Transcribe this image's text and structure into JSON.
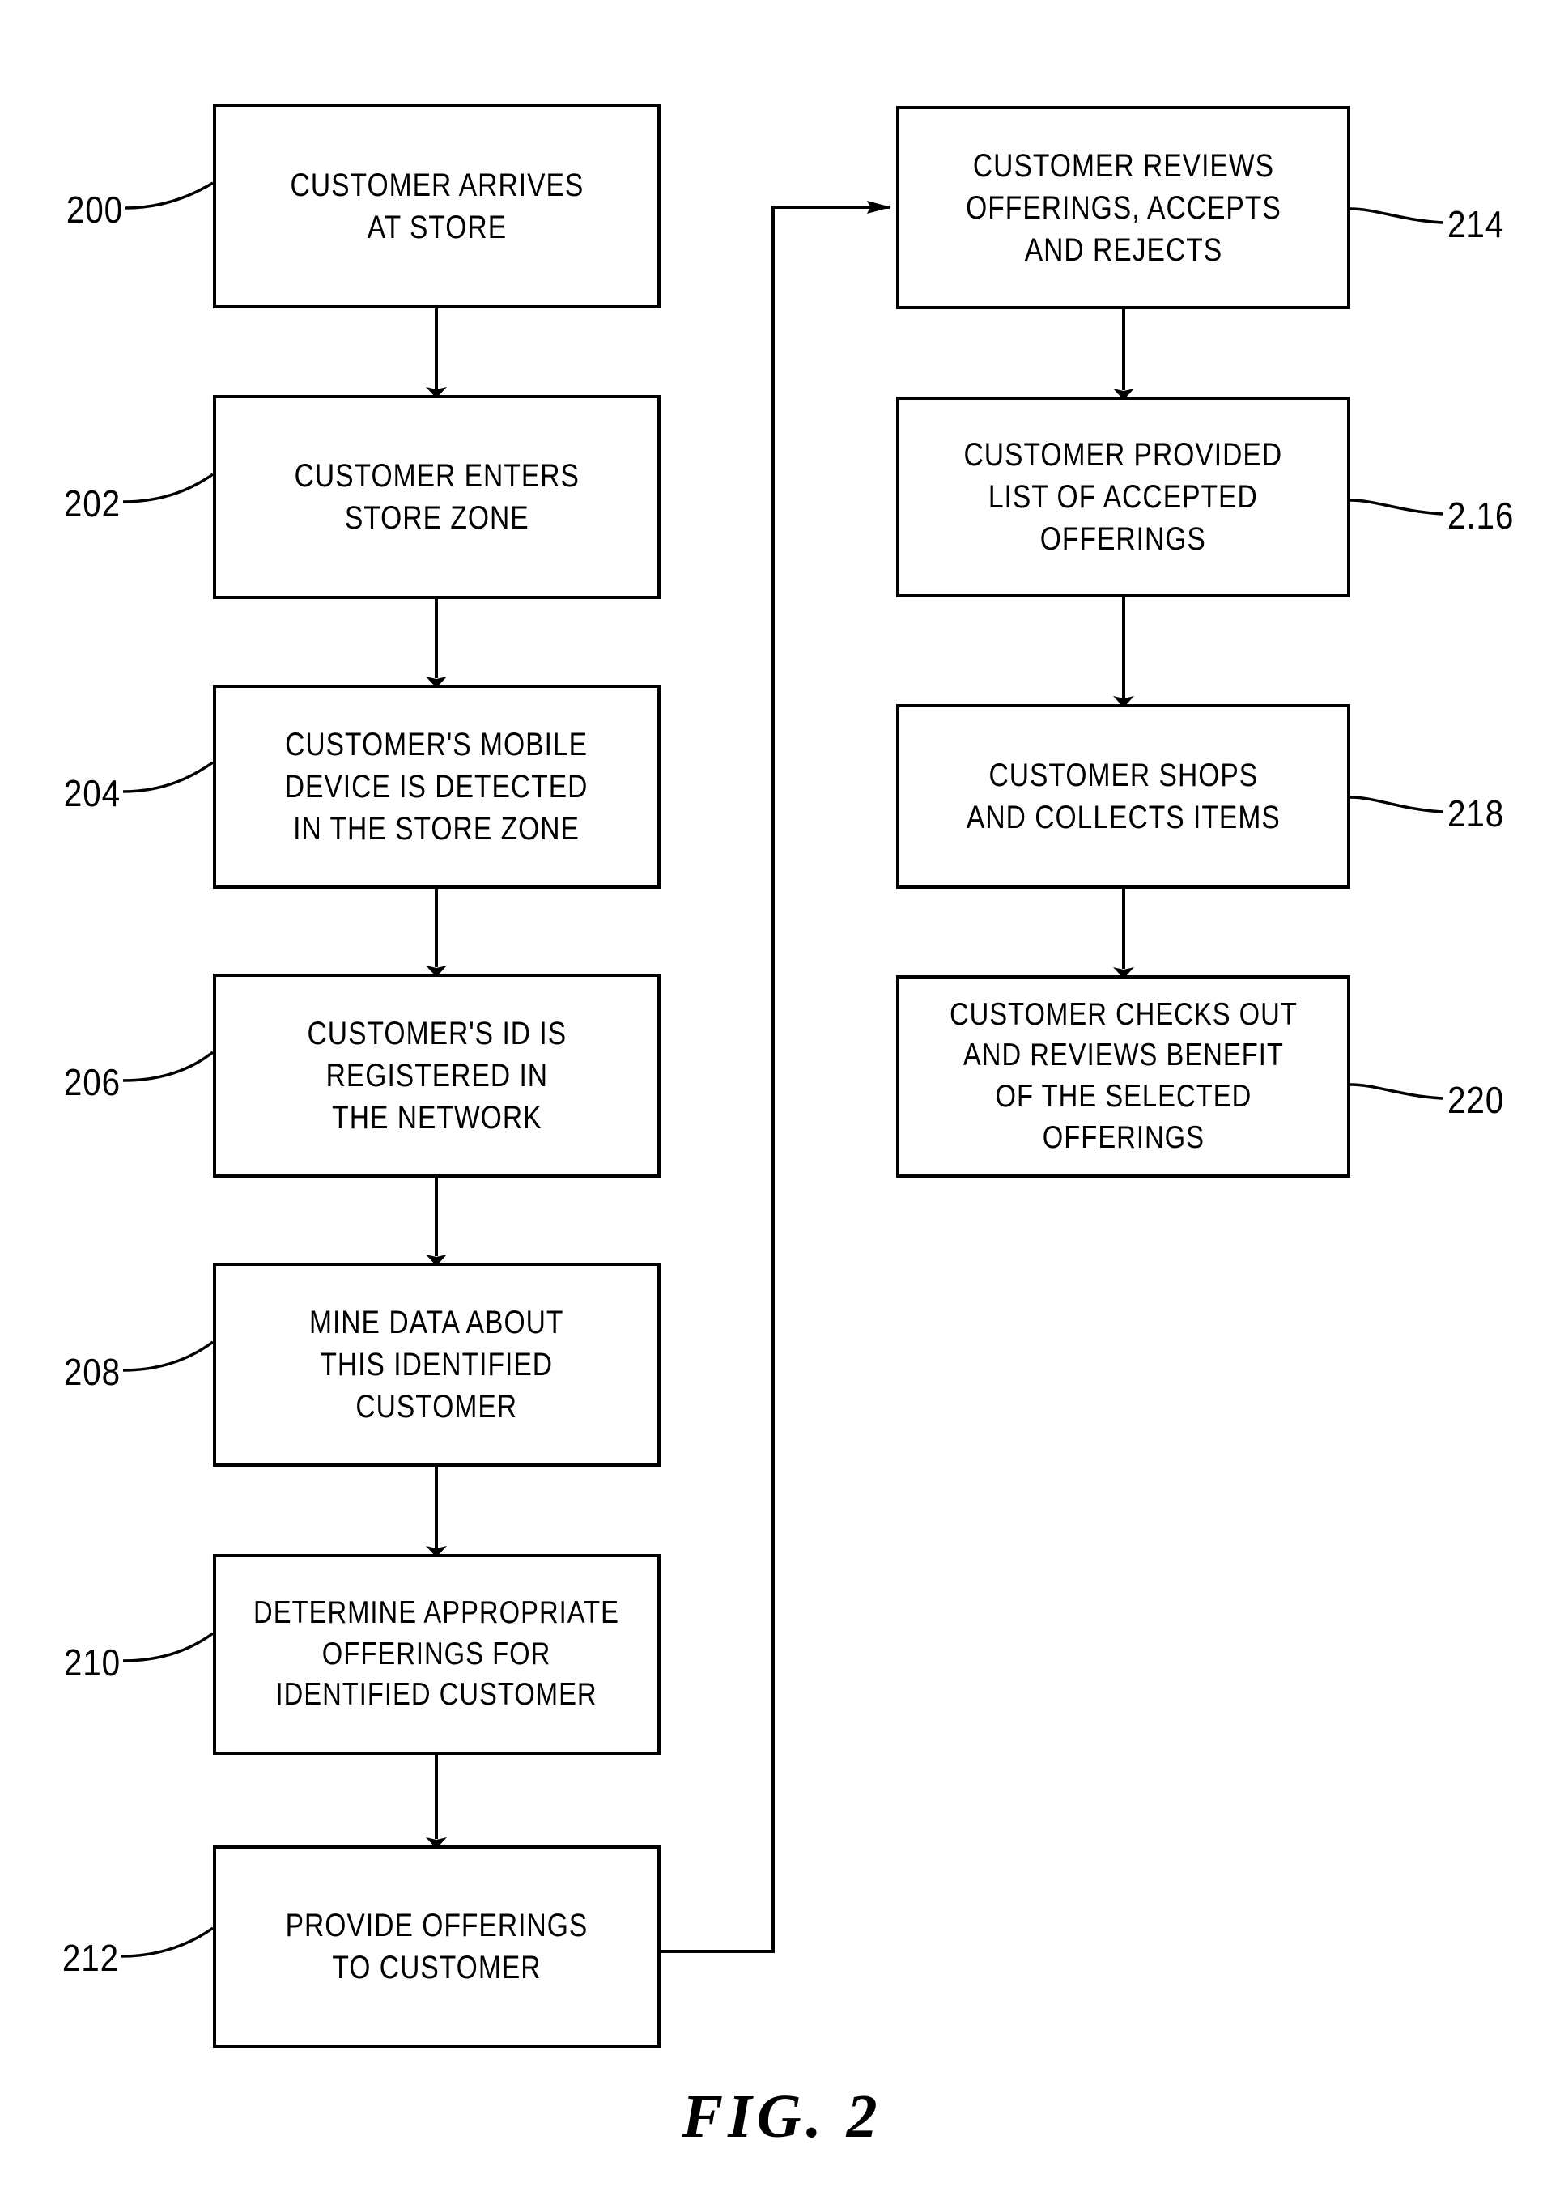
{
  "figure": {
    "caption": "FIG.  2",
    "type": "process-flowchart",
    "background_color": "#ffffff",
    "line_color": "#000000"
  },
  "nodes": [
    {
      "ref": "200",
      "ref_side": "left",
      "text": "CUSTOMER ARRIVES\nAT STORE",
      "column": "left"
    },
    {
      "ref": "202",
      "ref_side": "left",
      "text": "CUSTOMER ENTERS\nSTORE ZONE",
      "column": "left"
    },
    {
      "ref": "204",
      "ref_side": "left",
      "text": "CUSTOMER'S MOBILE\nDEVICE IS DETECTED\nIN THE STORE ZONE",
      "column": "left"
    },
    {
      "ref": "206",
      "ref_side": "left",
      "text": "CUSTOMER'S ID IS\nREGISTERED IN\nTHE NETWORK",
      "column": "left"
    },
    {
      "ref": "208",
      "ref_side": "left",
      "text": "MINE DATA ABOUT\nTHIS IDENTIFIED\nCUSTOMER",
      "column": "left"
    },
    {
      "ref": "210",
      "ref_side": "left",
      "text": "DETERMINE APPROPRIATE\nOFFERINGS FOR\nIDENTIFIED CUSTOMER",
      "column": "left"
    },
    {
      "ref": "212",
      "ref_side": "left",
      "text": "PROVIDE OFFERINGS\nTO CUSTOMER",
      "column": "left"
    },
    {
      "ref": "214",
      "ref_side": "right",
      "text": "CUSTOMER REVIEWS\nOFFERINGS, ACCEPTS\nAND REJECTS",
      "column": "right"
    },
    {
      "ref": "2.16",
      "ref_side": "right",
      "text": "CUSTOMER PROVIDED\nLIST OF ACCEPTED\nOFFERINGS",
      "column": "right"
    },
    {
      "ref": "218",
      "ref_side": "right",
      "text": "CUSTOMER SHOPS\nAND COLLECTS ITEMS",
      "column": "right"
    },
    {
      "ref": "220",
      "ref_side": "right",
      "text": "CUSTOMER CHECKS OUT\nAND REVIEWS BENEFIT\nOF THE SELECTED\nOFFERINGS",
      "column": "right"
    }
  ],
  "edges": [
    {
      "from": "200",
      "to": "202",
      "kind": "arrow-down"
    },
    {
      "from": "202",
      "to": "204",
      "kind": "arrow-down"
    },
    {
      "from": "204",
      "to": "206",
      "kind": "arrow-down"
    },
    {
      "from": "206",
      "to": "208",
      "kind": "arrow-down"
    },
    {
      "from": "208",
      "to": "210",
      "kind": "arrow-down"
    },
    {
      "from": "210",
      "to": "212",
      "kind": "arrow-down"
    },
    {
      "from": "212",
      "to": "214",
      "kind": "routed-arrow-right"
    },
    {
      "from": "214",
      "to": "2.16",
      "kind": "arrow-down"
    },
    {
      "from": "2.16",
      "to": "218",
      "kind": "arrow-down"
    },
    {
      "from": "218",
      "to": "220",
      "kind": "arrow-down"
    }
  ]
}
